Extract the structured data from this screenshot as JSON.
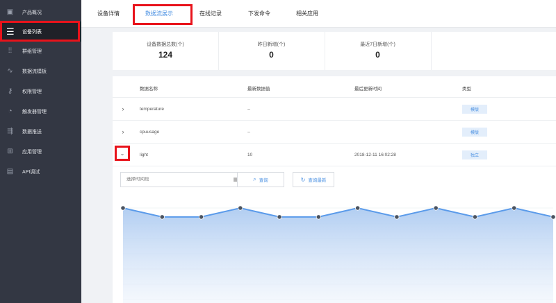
{
  "sidebar": {
    "items": [
      {
        "label": "产品概况",
        "icon": "cube-icon"
      },
      {
        "label": "设备列表",
        "icon": "list-icon",
        "active": true
      },
      {
        "label": "群组管理",
        "icon": "grid-dots-icon"
      },
      {
        "label": "数据流模板",
        "icon": "trend-icon"
      },
      {
        "label": "权限管理",
        "icon": "key-icon"
      },
      {
        "label": "触发器管理",
        "icon": "gauge-icon"
      },
      {
        "label": "数据推送",
        "icon": "push-icon"
      },
      {
        "label": "应用管理",
        "icon": "apps-icon"
      },
      {
        "label": "API调试",
        "icon": "api-icon"
      }
    ]
  },
  "tabs": [
    {
      "label": "设备详情"
    },
    {
      "label": "数据流展示",
      "active": true
    },
    {
      "label": "在线记录"
    },
    {
      "label": "下发命令"
    },
    {
      "label": "相关应用"
    }
  ],
  "stats": [
    {
      "label": "设备数据总数(个)",
      "value": "124"
    },
    {
      "label": "昨日新增(个)",
      "value": "0"
    },
    {
      "label": "最近7日新增(个)",
      "value": "0"
    }
  ],
  "table": {
    "headers": [
      "数据名称",
      "最新数据值",
      "最后更新时间",
      "类型"
    ],
    "rows": [
      {
        "name": "temperature",
        "value": "--",
        "time": "",
        "type": "模版"
      },
      {
        "name": "cpuusage",
        "value": "--",
        "time": "",
        "type": "模版"
      },
      {
        "name": "light",
        "value": "10",
        "time": "2018-12-11 16:02:28",
        "type": "独立",
        "expanded": true
      }
    ]
  },
  "filter": {
    "placeholder": "选择时间段",
    "query_label": "查询",
    "latest_label": "查询最新"
  },
  "colors": {
    "sidebar_bg": "#333743",
    "accent": "#4a90e2",
    "highlight": "#e8131b"
  },
  "chart_data": {
    "type": "area",
    "x": [
      1,
      2,
      3,
      4,
      5,
      6,
      7,
      8,
      9,
      10,
      11,
      12
    ],
    "series": [
      {
        "values": [
          10,
          7,
          7,
          10,
          7,
          7,
          10,
          7,
          10,
          7,
          10,
          7
        ]
      }
    ],
    "ylim": [
      0,
      10
    ],
    "grid": true,
    "color": "#5b9bea"
  }
}
